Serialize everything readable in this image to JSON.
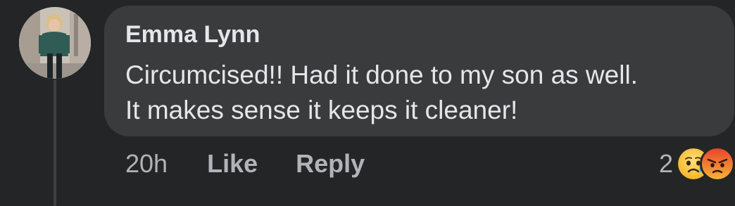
{
  "comment": {
    "author": "Emma Lynn",
    "text_lines": [
      "Circumcised!! Had it done to my son as well.",
      "It makes sense it keeps it cleaner!"
    ],
    "timestamp": "20h",
    "like_label": "Like",
    "reply_label": "Reply",
    "reaction_count": "2",
    "reactions": [
      "sad-icon",
      "angry-icon"
    ]
  },
  "colors": {
    "background": "#242526",
    "bubble": "#3a3b3c",
    "primary_text": "#e4e6eb",
    "secondary_text": "#b0b3b8"
  }
}
